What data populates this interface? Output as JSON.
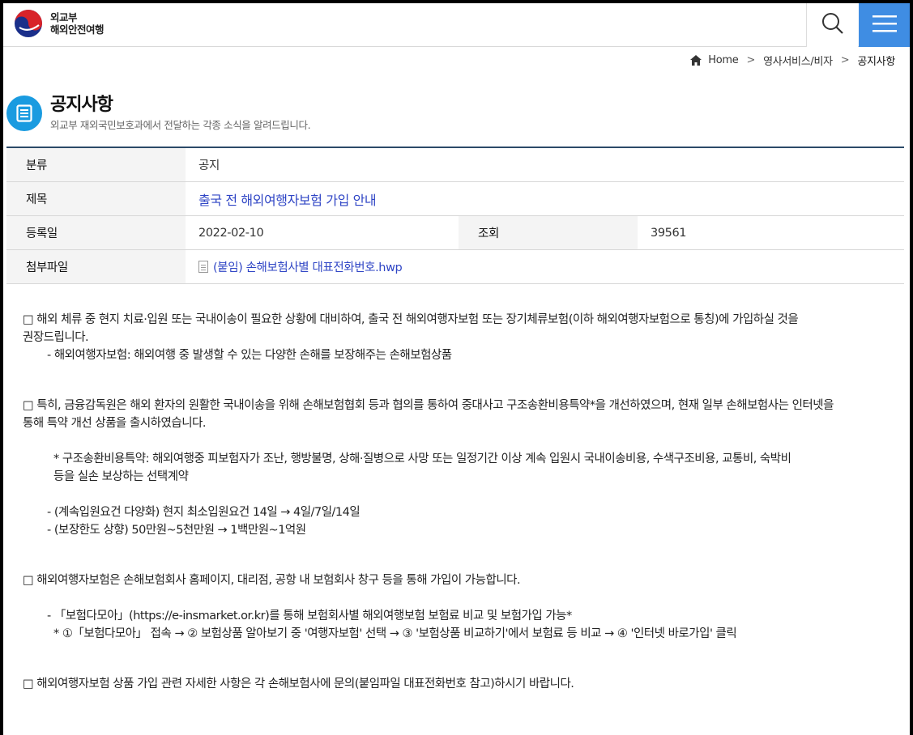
{
  "header": {
    "logo_line1": "외교부",
    "logo_line2": "해외안전여행",
    "accent_color": "#3f8de3"
  },
  "breadcrumb": {
    "home": "Home",
    "level1": "영사서비스/비자",
    "current": "공지사항"
  },
  "page": {
    "title": "공지사항",
    "subtitle": "외교부 재외국민보호과에서 전달하는 각종 소식을 알려드립니다."
  },
  "info": {
    "category_label": "분류",
    "category_value": "공지",
    "subject_label": "제목",
    "subject_value": "출국 전 해외여행자보험 가입 안내",
    "date_label": "등록일",
    "date_value": "2022-02-10",
    "views_label": "조회",
    "views_value": "39561",
    "attach_label": "첨부파일",
    "attach_value": "(붙임) 손해보험사별 대표전화번호.hwp"
  },
  "content": {
    "p1": "□ 해외 체류 중 현지 치료·입원 또는 국내이송이 필요한 상황에 대비하여, 출국 전 해외여행자보험 또는 장기체류보험(이하 해외여행자보험으로 통칭)에 가입하실 것을",
    "p1b": "권장드립니다.",
    "p1c": "- 해외여행자보험: 해외여행 중 발생할 수 있는 다양한 손해를 보장해주는 손해보험상품",
    "p2": "□ 특히, 금융감독원은 해외 환자의 원활한 국내이송을 위해 손해보험협회 등과 협의를 통하여 중대사고 구조송환비용특약*을 개선하였으며, 현재 일부 손해보험사는 인터넷을",
    "p2b": "통해 특약 개선 상품을 출시하였습니다.",
    "p2c": "* 구조송환비용특약: 해외여행중 피보험자가 조난, 행방불명, 상해·질병으로 사망 또는 일정기간 이상 계속 입원시 국내이송비용, 수색구조비용, 교통비, 숙박비",
    "p2d": "등을 실손 보상하는 선택계약",
    "p2e": "- (계속입원요건 다양화) 현지 최소입원요건 14일 → 4일/7일/14일",
    "p2f": "- (보장한도 상향) 50만원~5천만원 → 1백만원~1억원",
    "p3": "□ 해외여행자보험은 손해보험회사 홈페이지, 대리점, 공항 내 보험회사 창구 등을 통해 가입이 가능합니다.",
    "p3b": "- 「보험다모아」(https://e-insmarket.or.kr)를 통해 보험회사별 해외여행보험 보험료 비교 및 보험가입 가능*",
    "p3c": "* ①「보험다모아」 접속 → ② 보험상품 알아보기 중 '여행자보험' 선택 → ③ '보험상품 비교하기'에서 보험료 등 비교 → ④ '인터넷 바로가입' 클릭",
    "p4": "□ 해외여행자보험 상품 가입 관련 자세한 사항은 각 손해보험사에 문의(붙임파일 대표전화번호 참고)하시기 바랍니다."
  }
}
